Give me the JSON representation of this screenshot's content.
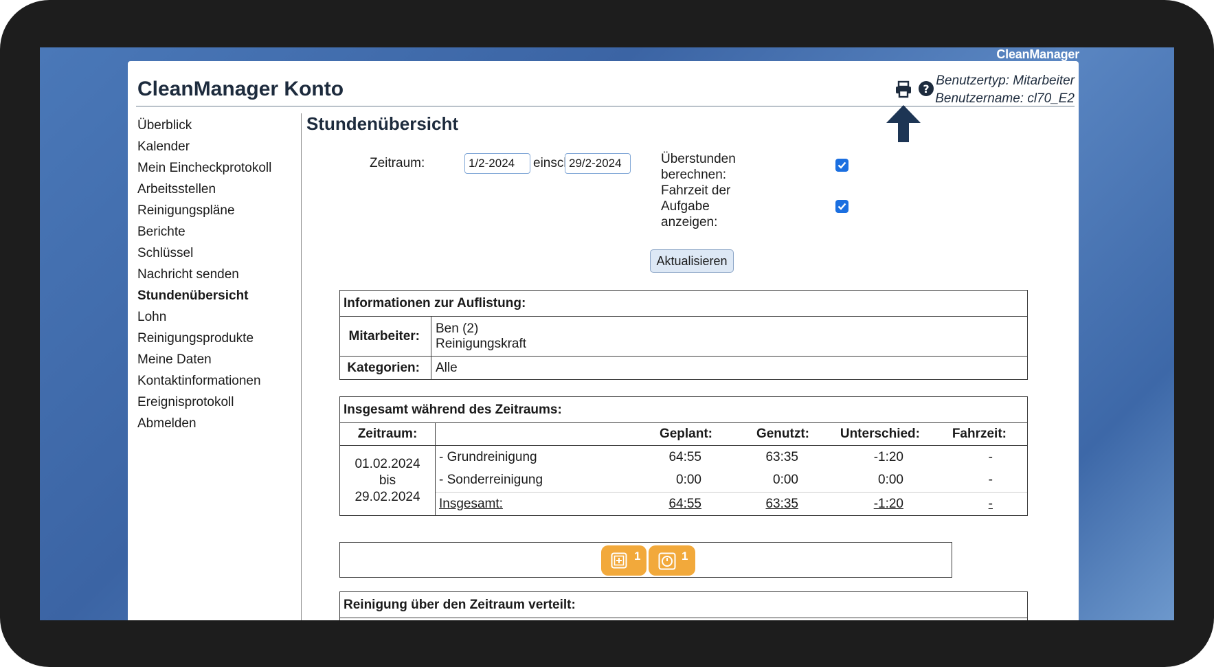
{
  "brand_label": "CleanManager",
  "app_title": "CleanManager Konto",
  "user": {
    "type_label": "Benutzertyp: Mitarbeiter",
    "name_label": "Benutzername: cl70_E2"
  },
  "icons": {
    "print": "printer-icon",
    "help": "question-circle-icon",
    "annotation": "up-arrow-annotation"
  },
  "sidebar": {
    "items": [
      {
        "label": "Überblick"
      },
      {
        "label": "Kalender"
      },
      {
        "label": "Mein Eincheckprotokoll"
      },
      {
        "label": "Arbeitsstellen"
      },
      {
        "label": "Reinigungspläne"
      },
      {
        "label": "Berichte"
      },
      {
        "label": "Schlüssel"
      },
      {
        "label": "Nachricht senden"
      },
      {
        "label": "Stundenübersicht",
        "active": true
      },
      {
        "label": "Lohn"
      },
      {
        "label": "Reinigungsprodukte"
      },
      {
        "label": "Meine Daten"
      },
      {
        "label": "Kontaktinformationen"
      },
      {
        "label": "Ereignisprotokoll"
      },
      {
        "label": "Abmelden"
      }
    ]
  },
  "main": {
    "heading": "Stundenübersicht",
    "filter": {
      "period_label": "Zeitraum:",
      "from_value": "1/2-2024",
      "between_label": "einschl.",
      "to_value": "29/2-2024",
      "overtime_label_1": "Überstunden",
      "overtime_label_2": "berechnen:",
      "overtime_checked": true,
      "travel_label_1": "Fahrzeit der",
      "travel_label_2": "Aufgabe",
      "travel_label_3": "anzeigen:",
      "travel_checked": true,
      "update_button": "Aktualisieren"
    },
    "info": {
      "title": "Informationen zur Auflistung:",
      "employee_label": "Mitarbeiter:",
      "employee_name": "Ben (2)",
      "employee_role": "Reinigungskraft",
      "categories_label": "Kategorien:",
      "categories_value": "Alle"
    },
    "totals": {
      "title": "Insgesamt während des Zeitraums:",
      "headers": {
        "period": "Zeitraum:",
        "planned": "Geplant:",
        "used": "Genutzt:",
        "difference": "Unterschied:",
        "travel": "Fahrzeit:"
      },
      "period_from": "01.02.2024",
      "period_sep": "bis",
      "period_to": "29.02.2024",
      "rows": [
        {
          "label": "- Grundreinigung",
          "planned": "64:55",
          "used": "63:35",
          "difference": "-1:20",
          "travel": "-"
        },
        {
          "label": "- Sonderreinigung",
          "planned": "0:00",
          "used": "0:00",
          "difference": "0:00",
          "travel": "-"
        }
      ],
      "sum": {
        "label": "Insgesamt:",
        "planned": "64:55",
        "used": "63:35",
        "difference": "-1:20",
        "travel": "-"
      }
    },
    "badges": [
      {
        "icon": "plus-square-icon",
        "count": "1"
      },
      {
        "icon": "clock-icon",
        "count": "1"
      }
    ],
    "distribution": {
      "title": "Reinigung über den Zeitraum verteilt:"
    }
  }
}
